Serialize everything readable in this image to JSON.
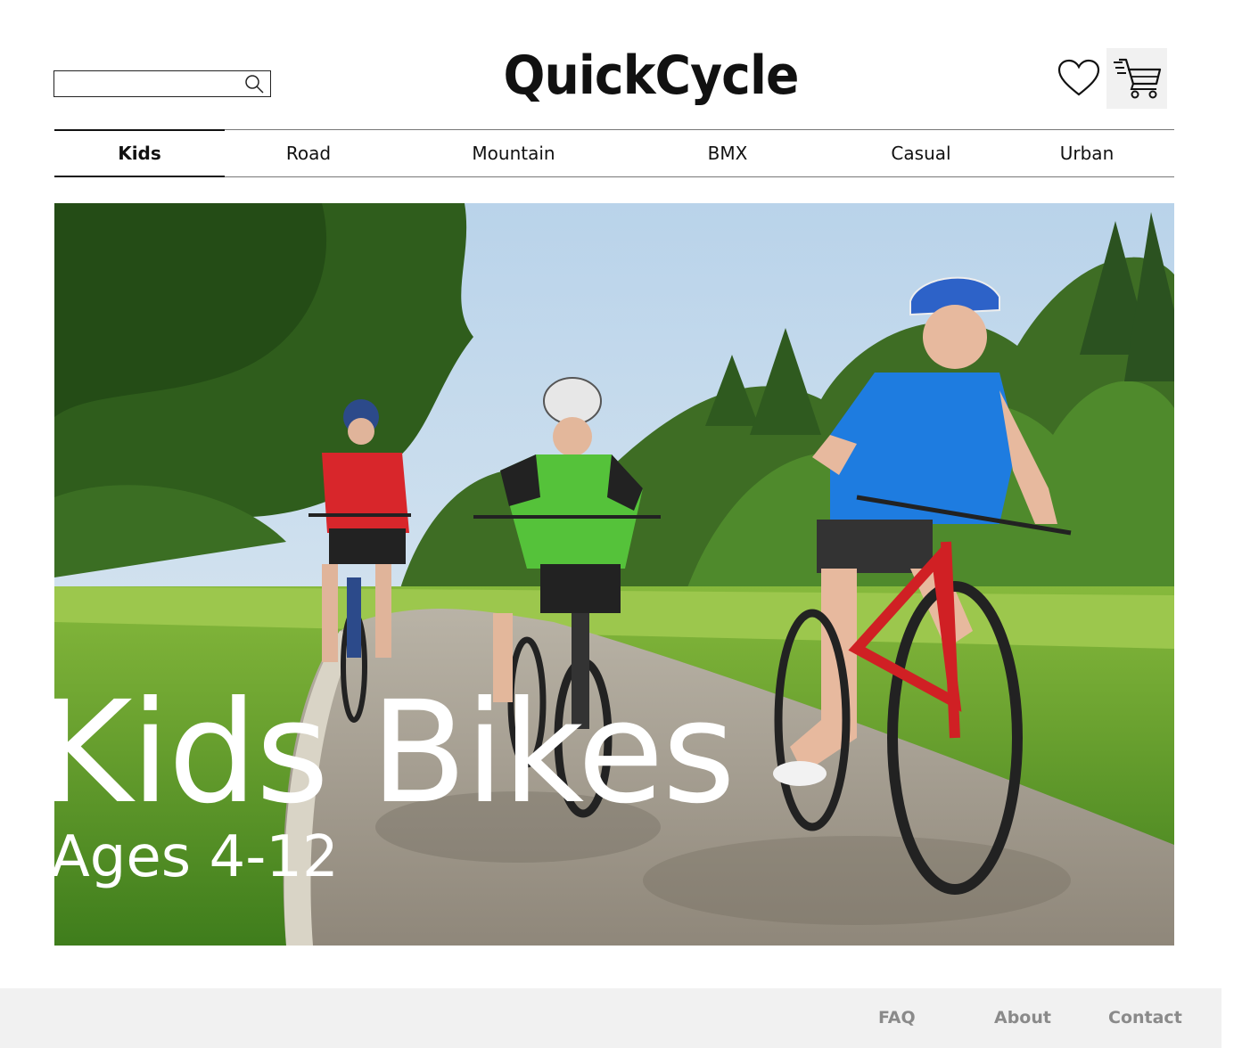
{
  "search": {
    "placeholder": "",
    "value": ""
  },
  "brand": {
    "name": "QuickCycle"
  },
  "header": {
    "icons": [
      "heart-icon",
      "cart-icon"
    ]
  },
  "nav": {
    "tabs": [
      {
        "label": "Kids",
        "active": true
      },
      {
        "label": "Road",
        "active": false
      },
      {
        "label": "Mountain",
        "active": false
      },
      {
        "label": "BMX",
        "active": false
      },
      {
        "label": "Casual",
        "active": false
      },
      {
        "label": "Urban",
        "active": false
      }
    ]
  },
  "hero": {
    "title": "Kids Bikes",
    "subtitle": "Ages 4-12"
  },
  "footer": {
    "links": [
      "FAQ",
      "About",
      "Contact"
    ]
  },
  "colors": {
    "footer_bg": "#f1f1f1",
    "footer_text": "#8a8a8a",
    "text": "#111111"
  }
}
